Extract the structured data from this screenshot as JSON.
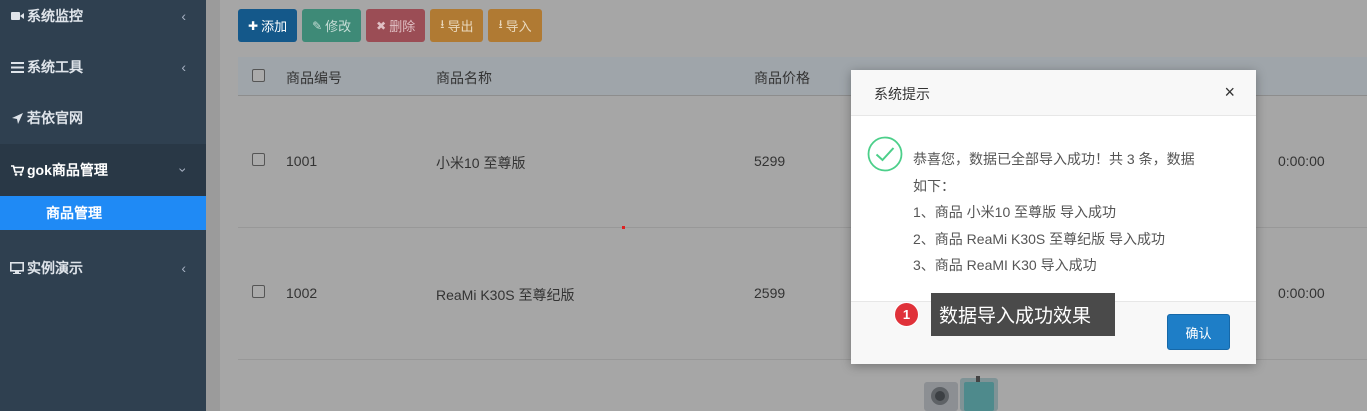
{
  "sidebar": {
    "items": [
      {
        "label": "系统监控",
        "icon": "video-camera-icon"
      },
      {
        "label": "系统工具",
        "icon": "bars-icon"
      },
      {
        "label": "若依官网",
        "icon": "location-arrow-icon"
      },
      {
        "label": "gok商品管理",
        "icon": "cart-icon"
      },
      {
        "label": "实例演示",
        "icon": "desktop-icon"
      }
    ],
    "active_sub": "商品管理"
  },
  "toolbar": {
    "add": "添加",
    "edit": "修改",
    "delete": "删除",
    "export": "导出",
    "import": "导入"
  },
  "table": {
    "columns": [
      "商品编号",
      "商品名称",
      "商品价格"
    ],
    "rows": [
      {
        "id": "1001",
        "name": "小米10 至尊版",
        "price": "5299",
        "time_tail": "0:00:00"
      },
      {
        "id": "1002",
        "name": "ReaMi K30S 至尊纪版",
        "price": "2599",
        "time_tail": "0:00:00"
      }
    ]
  },
  "modal": {
    "title": "系统提示",
    "close": "×",
    "message_lines": [
      "恭喜您，数据已全部导入成功！共 3 条，数据",
      "如下：",
      "1、商品 小米10 至尊版 导入成功",
      "2、商品 ReaMi K30S 至尊纪版 导入成功",
      "3、商品 ReaMI K30 导入成功"
    ],
    "confirm": "确认"
  },
  "annotation": {
    "badge": "1",
    "text": "数据导入成功效果"
  },
  "colors": {
    "sidebar_bg": "#2f4050",
    "active_sub_bg": "#1f8af5",
    "confirm_bg": "#1e7ec7",
    "success_icon": "#4ccf8a"
  }
}
